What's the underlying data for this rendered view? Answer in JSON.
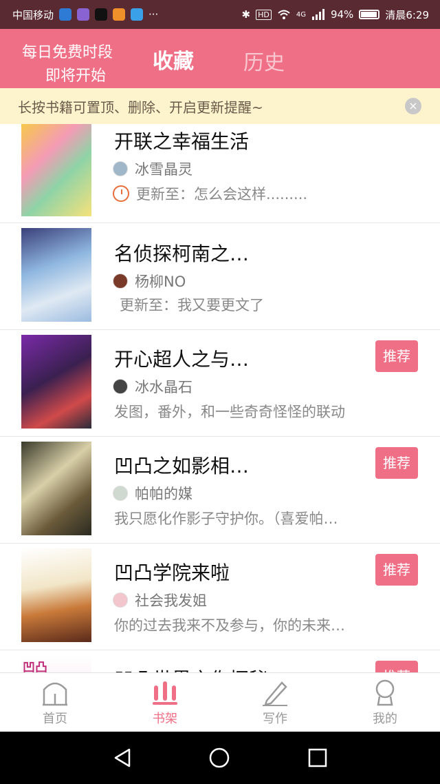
{
  "status_bar": {
    "carrier": "中国移动",
    "more": "···",
    "hd": "HD",
    "network": "4G",
    "battery": "94%",
    "battery_level": 0.94,
    "time": "清晨6:29"
  },
  "header": {
    "promo_line1": "每日免费时段",
    "promo_line2": "即将开始",
    "tab_favorites": "收藏",
    "tab_history": "历史"
  },
  "hint": {
    "text": "长按书籍可置顶、删除、开启更新提醒~",
    "close": "×"
  },
  "books": [
    {
      "title": "开联之幸福生活",
      "author": "冰雪晶灵",
      "desc": "更新至：怎么会这样.........",
      "update_icon": "clock-icon",
      "recommend": ""
    },
    {
      "title": "名侦探柯南之…",
      "author": "杨柳NO",
      "desc": "更新至：我又要更文了",
      "update_icon": "",
      "recommend": ""
    },
    {
      "title": "开心超人之与…",
      "author": "冰水晶石",
      "desc": "发图，番外，和一些奇奇怪怪的联动",
      "update_icon": "",
      "recommend": "推荐"
    },
    {
      "title": "凹凸之如影相…",
      "author": "帕帕的媒",
      "desc": "我只愿化作影子守护你。（喜爱帕…",
      "update_icon": "",
      "recommend": "推荐"
    },
    {
      "title": "凹凸学院来啦",
      "author": "社会我发姐",
      "desc": "你的过去我来不及参与，你的未来…",
      "update_icon": "",
      "recommend": "推荐"
    },
    {
      "title": "凹凸世界之你探秘",
      "author": "",
      "desc": "",
      "update_icon": "",
      "recommend": "推荐"
    }
  ],
  "bottom_nav": [
    {
      "label": "首页",
      "icon": "home-icon",
      "active": false
    },
    {
      "label": "书架",
      "icon": "bookshelf-icon",
      "active": true
    },
    {
      "label": "写作",
      "icon": "pencil-icon",
      "active": false
    },
    {
      "label": "我的",
      "icon": "profile-icon",
      "active": false
    }
  ],
  "colors": {
    "accent": "#ef6f86",
    "status_bar": "#5a2a33",
    "hint_bg": "#fdf3cc"
  }
}
